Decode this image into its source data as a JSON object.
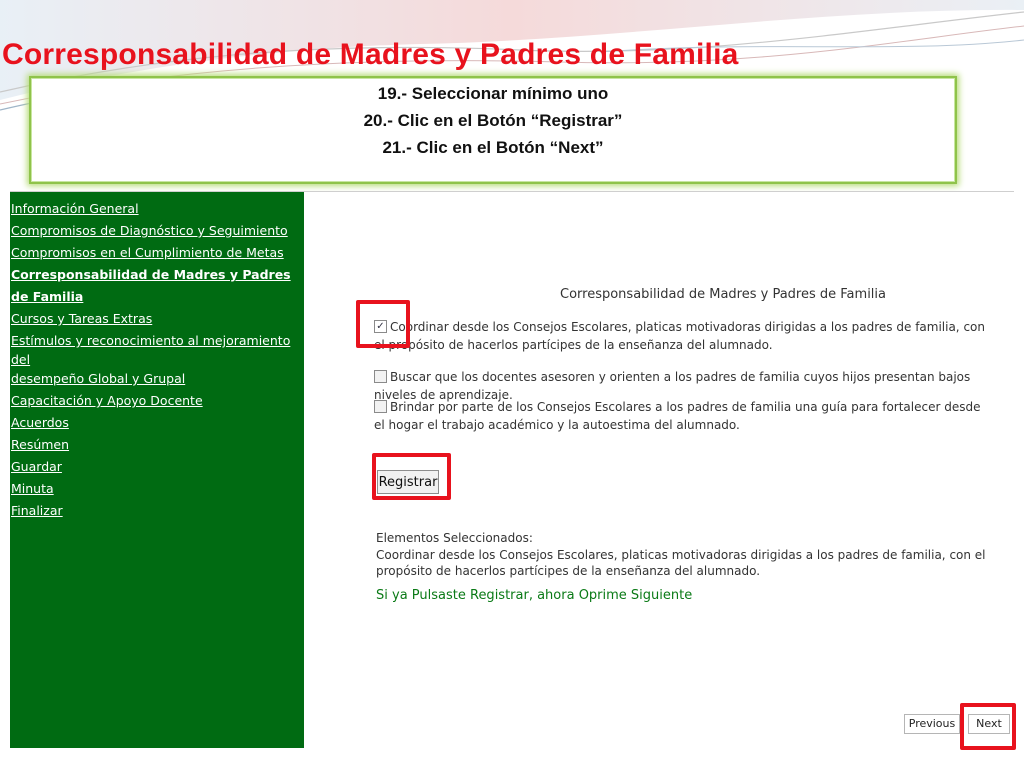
{
  "slide": {
    "title": "Corresponsabilidad de Madres y Padres de Familia",
    "instructions": [
      "19.- Seleccionar mínimo uno",
      "20.- Clic en el Botón  “Registrar”",
      "21.- Clic en el Botón “Next”"
    ]
  },
  "sidebar": {
    "items": [
      {
        "label": "Información General"
      },
      {
        "label": "Compromisos de Diagnóstico y Seguimiento"
      },
      {
        "label": "Compromisos en el Cumplimiento de Metas"
      },
      {
        "label": "Corresponsabilidad de Madres y Padres de Familia"
      },
      {
        "label": "Cursos y Tareas Extras"
      },
      {
        "label": "Estímulos y reconocimiento al mejoramiento del",
        "label2": "desempeño Global y Grupal"
      },
      {
        "label": "Capacitación y Apoyo Docente"
      },
      {
        "label": "Acuerdos"
      },
      {
        "label": "Resúmen"
      },
      {
        "label": "Guardar"
      },
      {
        "label": "Minuta"
      },
      {
        "label": "Finalizar"
      }
    ]
  },
  "form": {
    "title": "Corresponsabilidad de Madres y Padres de Familia",
    "options": [
      {
        "checked": true,
        "text": "Coordinar desde los Consejos Escolares, platicas motivadoras dirigidas a los padres de familia, con el propósito de hacerlos partícipes de la enseñanza del alumnado."
      },
      {
        "checked": false,
        "text": "Buscar que los docentes asesoren y orienten a los padres de familia cuyos hijos presentan bajos niveles de aprendizaje."
      },
      {
        "checked": false,
        "text": "Brindar por parte de los Consejos Escolares a los padres de familia una guía para fortalecer desde el hogar el trabajo académico y la autoestima del alumnado."
      }
    ],
    "register_label": "Registrar",
    "selected_label": "Elementos Seleccionados:",
    "selected_text": "Coordinar desde los Consejos Escolares, platicas motivadoras dirigidas a los padres de familia, con el propósito de hacerlos partícipes de la enseñanza del alumnado.",
    "hint": "Si ya Pulsaste Registrar, ahora Oprime Siguiente"
  },
  "pager": {
    "previous_label": "Previous",
    "next_label": "Next"
  },
  "colors": {
    "title_red": "#e8121d",
    "sidebar_green": "#006b12",
    "highlight_red": "#e8121d",
    "hint_green": "#0a7a16",
    "instr_border": "#8fc34a"
  }
}
